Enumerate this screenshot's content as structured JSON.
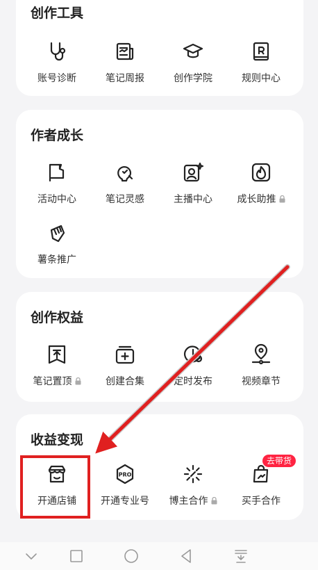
{
  "sections": {
    "creation_tools": {
      "title": "创作工具",
      "items": [
        "账号诊断",
        "笔记周报",
        "创作学院",
        "规则中心"
      ]
    },
    "author_growth": {
      "title": "作者成长",
      "items": [
        "活动中心",
        "笔记灵感",
        "主播中心",
        "成长助推",
        "薯条推广"
      ]
    },
    "creator_rights": {
      "title": "创作权益",
      "items": [
        "笔记置顶",
        "创建合集",
        "定时发布",
        "视频章节"
      ]
    },
    "monetization": {
      "title": "收益变现",
      "items": [
        "开通店铺",
        "开通专业号",
        "博主合作",
        "买手合作"
      ],
      "badge": "去带货"
    }
  },
  "colors": {
    "accent": "#ff2442",
    "highlight": "#e02020",
    "text": "#333333"
  },
  "icons": {
    "creation_tools": [
      "stethoscope-icon",
      "report-icon",
      "graduation-cap-icon",
      "rule-book-icon"
    ],
    "author_growth": [
      "flag-icon",
      "lightbulb-icon",
      "streamer-icon",
      "flame-icon",
      "fries-icon"
    ],
    "creator_rights": [
      "pin-top-icon",
      "add-collection-icon",
      "clock-icon",
      "video-chapter-icon"
    ],
    "monetization": [
      "store-icon",
      "pro-badge-icon",
      "sparkle-icon",
      "shopping-bag-icon"
    ]
  },
  "nav": [
    "collapse-icon",
    "recent-apps-icon",
    "home-icon",
    "back-icon",
    "notification-drawer-icon"
  ]
}
